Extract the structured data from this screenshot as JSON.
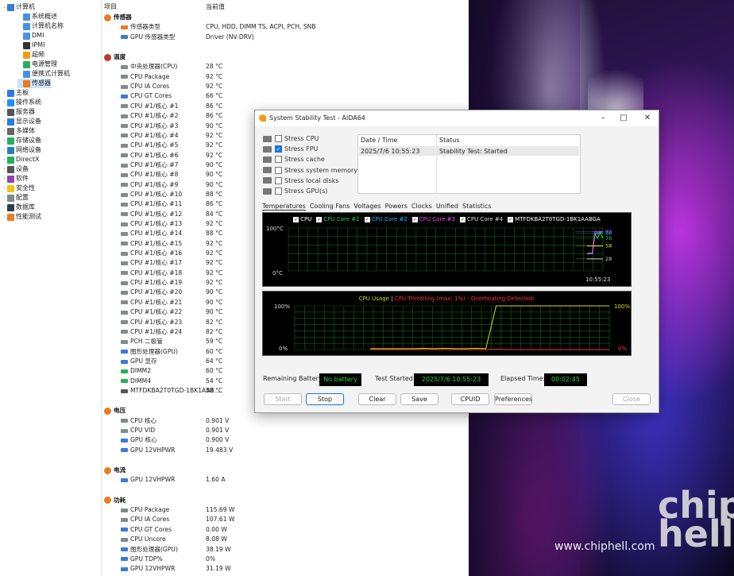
{
  "tree": [
    {
      "label": "计算机",
      "icon": "computer-icon",
      "color": "#3a7bd5",
      "level": 0,
      "expander": "⌄"
    },
    {
      "label": "系统概述",
      "icon": "summary-icon",
      "color": "#4a90e2",
      "level": 1
    },
    {
      "label": "计算机名称",
      "icon": "computer-name-icon",
      "color": "#4a90e2",
      "level": 1
    },
    {
      "label": "DMI",
      "icon": "dmi-icon",
      "color": "#4a90e2",
      "level": 1
    },
    {
      "label": "IPMI",
      "icon": "ipmi-icon",
      "color": "#333333",
      "level": 1
    },
    {
      "label": "超频",
      "icon": "overclock-icon",
      "color": "#f39c12",
      "level": 1
    },
    {
      "label": "电源管理",
      "icon": "power-icon",
      "color": "#27ae60",
      "level": 1
    },
    {
      "label": "便携式计算机",
      "icon": "laptop-icon",
      "color": "#4a90e2",
      "level": 1
    },
    {
      "label": "传感器",
      "icon": "sensor-icon",
      "color": "#e67e22",
      "level": 1,
      "selected": true
    },
    {
      "label": "主板",
      "icon": "motherboard-icon",
      "color": "#2c7be5",
      "level": 0,
      "expander": "›"
    },
    {
      "label": "操作系统",
      "icon": "os-icon",
      "color": "#1e90ff",
      "level": 0,
      "expander": "›"
    },
    {
      "label": "服务器",
      "icon": "server-icon",
      "color": "#555555",
      "level": 0,
      "expander": "›"
    },
    {
      "label": "显示设备",
      "icon": "display-icon",
      "color": "#2c7be5",
      "level": 0,
      "expander": "›"
    },
    {
      "label": "多媒体",
      "icon": "multimedia-icon",
      "color": "#666666",
      "level": 0,
      "expander": "›"
    },
    {
      "label": "存储设备",
      "icon": "storage-icon",
      "color": "#27ae60",
      "level": 0,
      "expander": "›"
    },
    {
      "label": "网络设备",
      "icon": "network-icon",
      "color": "#2980b9",
      "level": 0,
      "expander": "›"
    },
    {
      "label": "DirectX",
      "icon": "directx-icon",
      "color": "#27ae60",
      "level": 0,
      "expander": "›"
    },
    {
      "label": "设备",
      "icon": "devices-icon",
      "color": "#555555",
      "level": 0,
      "expander": "›"
    },
    {
      "label": "软件",
      "icon": "software-icon",
      "color": "#8e44ad",
      "level": 0,
      "expander": "›"
    },
    {
      "label": "安全性",
      "icon": "security-icon",
      "color": "#f1c40f",
      "level": 0,
      "expander": "›"
    },
    {
      "label": "配置",
      "icon": "config-icon",
      "color": "#7f8c8d",
      "level": 0,
      "expander": "›"
    },
    {
      "label": "数据库",
      "icon": "database-icon",
      "color": "#2c3e50",
      "level": 0,
      "expander": "›"
    },
    {
      "label": "性能测试",
      "icon": "benchmark-icon",
      "color": "#e67e22",
      "level": 0,
      "expander": "›"
    }
  ],
  "list": {
    "col_item": "项目",
    "col_value": "当前值",
    "rows": [
      {
        "type": "sec",
        "name": "传感器",
        "icon": "sensor-icon",
        "color": "#e67e22"
      },
      {
        "name": "传感器类型",
        "value": "CPU, HDD, DIMM TS, ACPI, PCH, SNB",
        "color": "#e67e22"
      },
      {
        "name": "GPU 传感器类型",
        "value": "Driver  (NV-DRV)",
        "color": "#3a7bd5"
      },
      {
        "type": "gap"
      },
      {
        "type": "sec",
        "name": "温度",
        "icon": "temperature-icon",
        "color": "#c0392b"
      },
      {
        "name": "中央处理器(CPU)",
        "value": "28 °C",
        "color": "#7f8c8d"
      },
      {
        "name": "CPU Package",
        "value": "92 °C",
        "color": "#7f8c8d"
      },
      {
        "name": "CPU IA Cores",
        "value": "92 °C",
        "color": "#7f8c8d"
      },
      {
        "name": "CPU GT Cores",
        "value": "66 °C",
        "color": "#3a7bd5"
      },
      {
        "name": "CPU #1/核心 #1",
        "value": "86 °C",
        "color": "#7f8c8d"
      },
      {
        "name": "CPU #1/核心 #2",
        "value": "86 °C",
        "color": "#7f8c8d"
      },
      {
        "name": "CPU #1/核心 #3",
        "value": "90 °C",
        "color": "#7f8c8d"
      },
      {
        "name": "CPU #1/核心 #4",
        "value": "92 °C",
        "color": "#7f8c8d"
      },
      {
        "name": "CPU #1/核心 #5",
        "value": "92 °C",
        "color": "#7f8c8d"
      },
      {
        "name": "CPU #1/核心 #6",
        "value": "92 °C",
        "color": "#7f8c8d"
      },
      {
        "name": "CPU #1/核心 #7",
        "value": "90 °C",
        "color": "#7f8c8d"
      },
      {
        "name": "CPU #1/核心 #8",
        "value": "90 °C",
        "color": "#7f8c8d"
      },
      {
        "name": "CPU #1/核心 #9",
        "value": "90 °C",
        "color": "#7f8c8d"
      },
      {
        "name": "CPU #1/核心 #10",
        "value": "88 °C",
        "color": "#7f8c8d"
      },
      {
        "name": "CPU #1/核心 #11",
        "value": "86 °C",
        "color": "#7f8c8d"
      },
      {
        "name": "CPU #1/核心 #12",
        "value": "84 °C",
        "color": "#7f8c8d"
      },
      {
        "name": "CPU #1/核心 #13",
        "value": "92 °C",
        "color": "#7f8c8d"
      },
      {
        "name": "CPU #1/核心 #14",
        "value": "88 °C",
        "color": "#7f8c8d"
      },
      {
        "name": "CPU #1/核心 #15",
        "value": "92 °C",
        "color": "#7f8c8d"
      },
      {
        "name": "CPU #1/核心 #16",
        "value": "92 °C",
        "color": "#7f8c8d"
      },
      {
        "name": "CPU #1/核心 #17",
        "value": "92 °C",
        "color": "#7f8c8d"
      },
      {
        "name": "CPU #1/核心 #18",
        "value": "92 °C",
        "color": "#7f8c8d"
      },
      {
        "name": "CPU #1/核心 #19",
        "value": "92 °C",
        "color": "#7f8c8d"
      },
      {
        "name": "CPU #1/核心 #20",
        "value": "90 °C",
        "color": "#7f8c8d"
      },
      {
        "name": "CPU #1/核心 #21",
        "value": "90 °C",
        "color": "#7f8c8d"
      },
      {
        "name": "CPU #1/核心 #22",
        "value": "90 °C",
        "color": "#7f8c8d"
      },
      {
        "name": "CPU #1/核心 #23",
        "value": "82 °C",
        "color": "#7f8c8d"
      },
      {
        "name": "CPU #1/核心 #24",
        "value": "82 °C",
        "color": "#7f8c8d"
      },
      {
        "name": "PCH 二极管",
        "value": "59 °C",
        "color": "#7f8c8d"
      },
      {
        "name": "图形处理器(GPU)",
        "value": "60 °C",
        "color": "#3a7bd5"
      },
      {
        "name": "GPU 显存",
        "value": "64 °C",
        "color": "#3a7bd5"
      },
      {
        "name": "DIMM2",
        "value": "60 °C",
        "color": "#27ae60"
      },
      {
        "name": "DIMM4",
        "value": "54 °C",
        "color": "#27ae60"
      },
      {
        "name": "MTFDKBA2T0TGD-1BK1AA8...",
        "value": "58 °C",
        "color": "#555555"
      },
      {
        "type": "gap"
      },
      {
        "type": "sec",
        "name": "电压",
        "icon": "voltage-icon",
        "color": "#e67e22"
      },
      {
        "name": "CPU 核心",
        "value": "0.901 V",
        "color": "#7f8c8d"
      },
      {
        "name": "CPU VID",
        "value": "0.901 V",
        "color": "#7f8c8d"
      },
      {
        "name": "GPU 核心",
        "value": "0.900 V",
        "color": "#3a7bd5"
      },
      {
        "name": "GPU 12VHPWR",
        "value": "19.483 V",
        "color": "#3a7bd5"
      },
      {
        "type": "gap"
      },
      {
        "type": "sec",
        "name": "电流",
        "icon": "current-icon",
        "color": "#e67e22"
      },
      {
        "name": "GPU 12VHPWR",
        "value": "1.60 A",
        "color": "#3a7bd5"
      },
      {
        "type": "gap"
      },
      {
        "type": "sec",
        "name": "功耗",
        "icon": "power-consumption-icon",
        "color": "#e67e22"
      },
      {
        "name": "CPU Package",
        "value": "115.69 W",
        "color": "#7f8c8d"
      },
      {
        "name": "CPU IA Cores",
        "value": "107.61 W",
        "color": "#7f8c8d"
      },
      {
        "name": "CPU GT Cores",
        "value": "0.00 W",
        "color": "#3a7bd5"
      },
      {
        "name": "CPU Uncore",
        "value": "8.08 W",
        "color": "#7f8c8d"
      },
      {
        "name": "图形处理器(GPU)",
        "value": "38.19 W",
        "color": "#3a7bd5"
      },
      {
        "name": "GPU TDP%",
        "value": "0%",
        "color": "#3a7bd5"
      },
      {
        "name": "GPU 12VHPWR",
        "value": "31.19 W",
        "color": "#3a7bd5"
      }
    ]
  },
  "window": {
    "title": "System Stability Test - AIDA64",
    "stress": [
      {
        "label": "Stress CPU",
        "checked": false,
        "icon": "cpu-icon"
      },
      {
        "label": "Stress FPU",
        "checked": true,
        "icon": "fpu-icon"
      },
      {
        "label": "Stress cache",
        "checked": false,
        "icon": "cache-icon"
      },
      {
        "label": "Stress system memory",
        "checked": false,
        "icon": "memory-icon"
      },
      {
        "label": "Stress local disks",
        "checked": false,
        "icon": "disk-icon"
      },
      {
        "label": "Stress GPU(s)",
        "checked": false,
        "icon": "gpu-icon"
      }
    ],
    "status_table": {
      "col_date": "Date / Time",
      "col_status": "Status",
      "date": "2025/7/6 10:55:23",
      "status": "Stability Test: Started"
    },
    "tabs": [
      "Temperatures",
      "Cooling Fans",
      "Voltages",
      "Powers",
      "Clocks",
      "Unified",
      "Statistics"
    ],
    "remaining_battery_label": "Remaining Battery:",
    "remaining_battery": "No battery",
    "test_started_label": "Test Started:",
    "test_started": "2025/7/6 10:55:23",
    "elapsed_label": "Elapsed Time:",
    "elapsed": "00:02:45",
    "buttons": {
      "start": "Start",
      "stop": "Stop",
      "clear": "Clear",
      "save": "Save",
      "cpuid": "CPUID",
      "preferences": "Preferences",
      "close": "Close"
    }
  },
  "chart_data": [
    {
      "type": "line",
      "title": "",
      "ylim": [
        0,
        100
      ],
      "y_top_label": "100°C",
      "y_bottom_label": "0°C",
      "time_label": "10:55:23",
      "legend": [
        {
          "name": "CPU",
          "color": "#ffffff",
          "checked": true
        },
        {
          "name": "CPU Core #1",
          "color": "#2ecc40",
          "checked": true
        },
        {
          "name": "CPU Core #2",
          "color": "#00bfff",
          "checked": true
        },
        {
          "name": "CPU Core #3",
          "color": "#ff44ff",
          "checked": true
        },
        {
          "name": "CPU Core #4",
          "color": "#dddddd",
          "checked": true
        },
        {
          "name": "MTFDKBA2T0TGD-1BK1AABGA",
          "color": "#ffffff",
          "checked": true
        }
      ],
      "value_labels": [
        {
          "text": "92",
          "color": "#ff44ff"
        },
        {
          "text": "88",
          "color": "#00bfff"
        },
        {
          "text": "76",
          "color": "#2ecc40"
        },
        {
          "text": "58",
          "color": "#ffdd00"
        },
        {
          "text": "28",
          "color": "#cccccc"
        }
      ],
      "series": [
        {
          "name": "CPU",
          "color": "#cccccc",
          "values": [
            28,
            28,
            28,
            28,
            28,
            28,
            28
          ]
        },
        {
          "name": "CPU Core #1",
          "color": "#2ecc40",
          "values": [
            40,
            42,
            40,
            86,
            76,
            90,
            76
          ]
        },
        {
          "name": "CPU Core #2",
          "color": "#00bfff",
          "values": [
            40,
            40,
            42,
            88,
            86,
            90,
            88
          ]
        },
        {
          "name": "CPU Core #3",
          "color": "#ff44ff",
          "values": [
            40,
            40,
            40,
            92,
            90,
            92,
            92
          ]
        },
        {
          "name": "MTFDKBA2T0TGD-1BK1AABGA",
          "color": "#ffdd00",
          "values": [
            58,
            58,
            58,
            58,
            58,
            58,
            58
          ]
        }
      ]
    },
    {
      "type": "line",
      "title": "",
      "ylim": [
        0,
        100
      ],
      "y_top_label": "100%",
      "y_bottom_label": "0%",
      "right_top_label": "100%",
      "right_bottom_label": "0%",
      "header_usage": "CPU Usage",
      "header_sep": "|",
      "header_throttle": "CPU Throttling (max: 1%) - Overheating Detected!",
      "series": [
        {
          "name": "CPU Usage",
          "color": "#dddd00",
          "values": [
            2,
            3,
            2,
            3,
            2,
            2,
            3,
            2,
            100,
            100,
            100,
            100,
            100,
            100,
            100,
            100,
            100,
            100,
            100,
            100
          ]
        },
        {
          "name": "CPU Throttling",
          "color": "#ff3333",
          "values": [
            0,
            0,
            0,
            0,
            0,
            0,
            0,
            0,
            1,
            0,
            0,
            0,
            0,
            0,
            0,
            0,
            0,
            0,
            0,
            0
          ]
        }
      ]
    }
  ],
  "wallpaper": {
    "watermark": "www.chiphell.com",
    "logo_text": "chip hell"
  }
}
